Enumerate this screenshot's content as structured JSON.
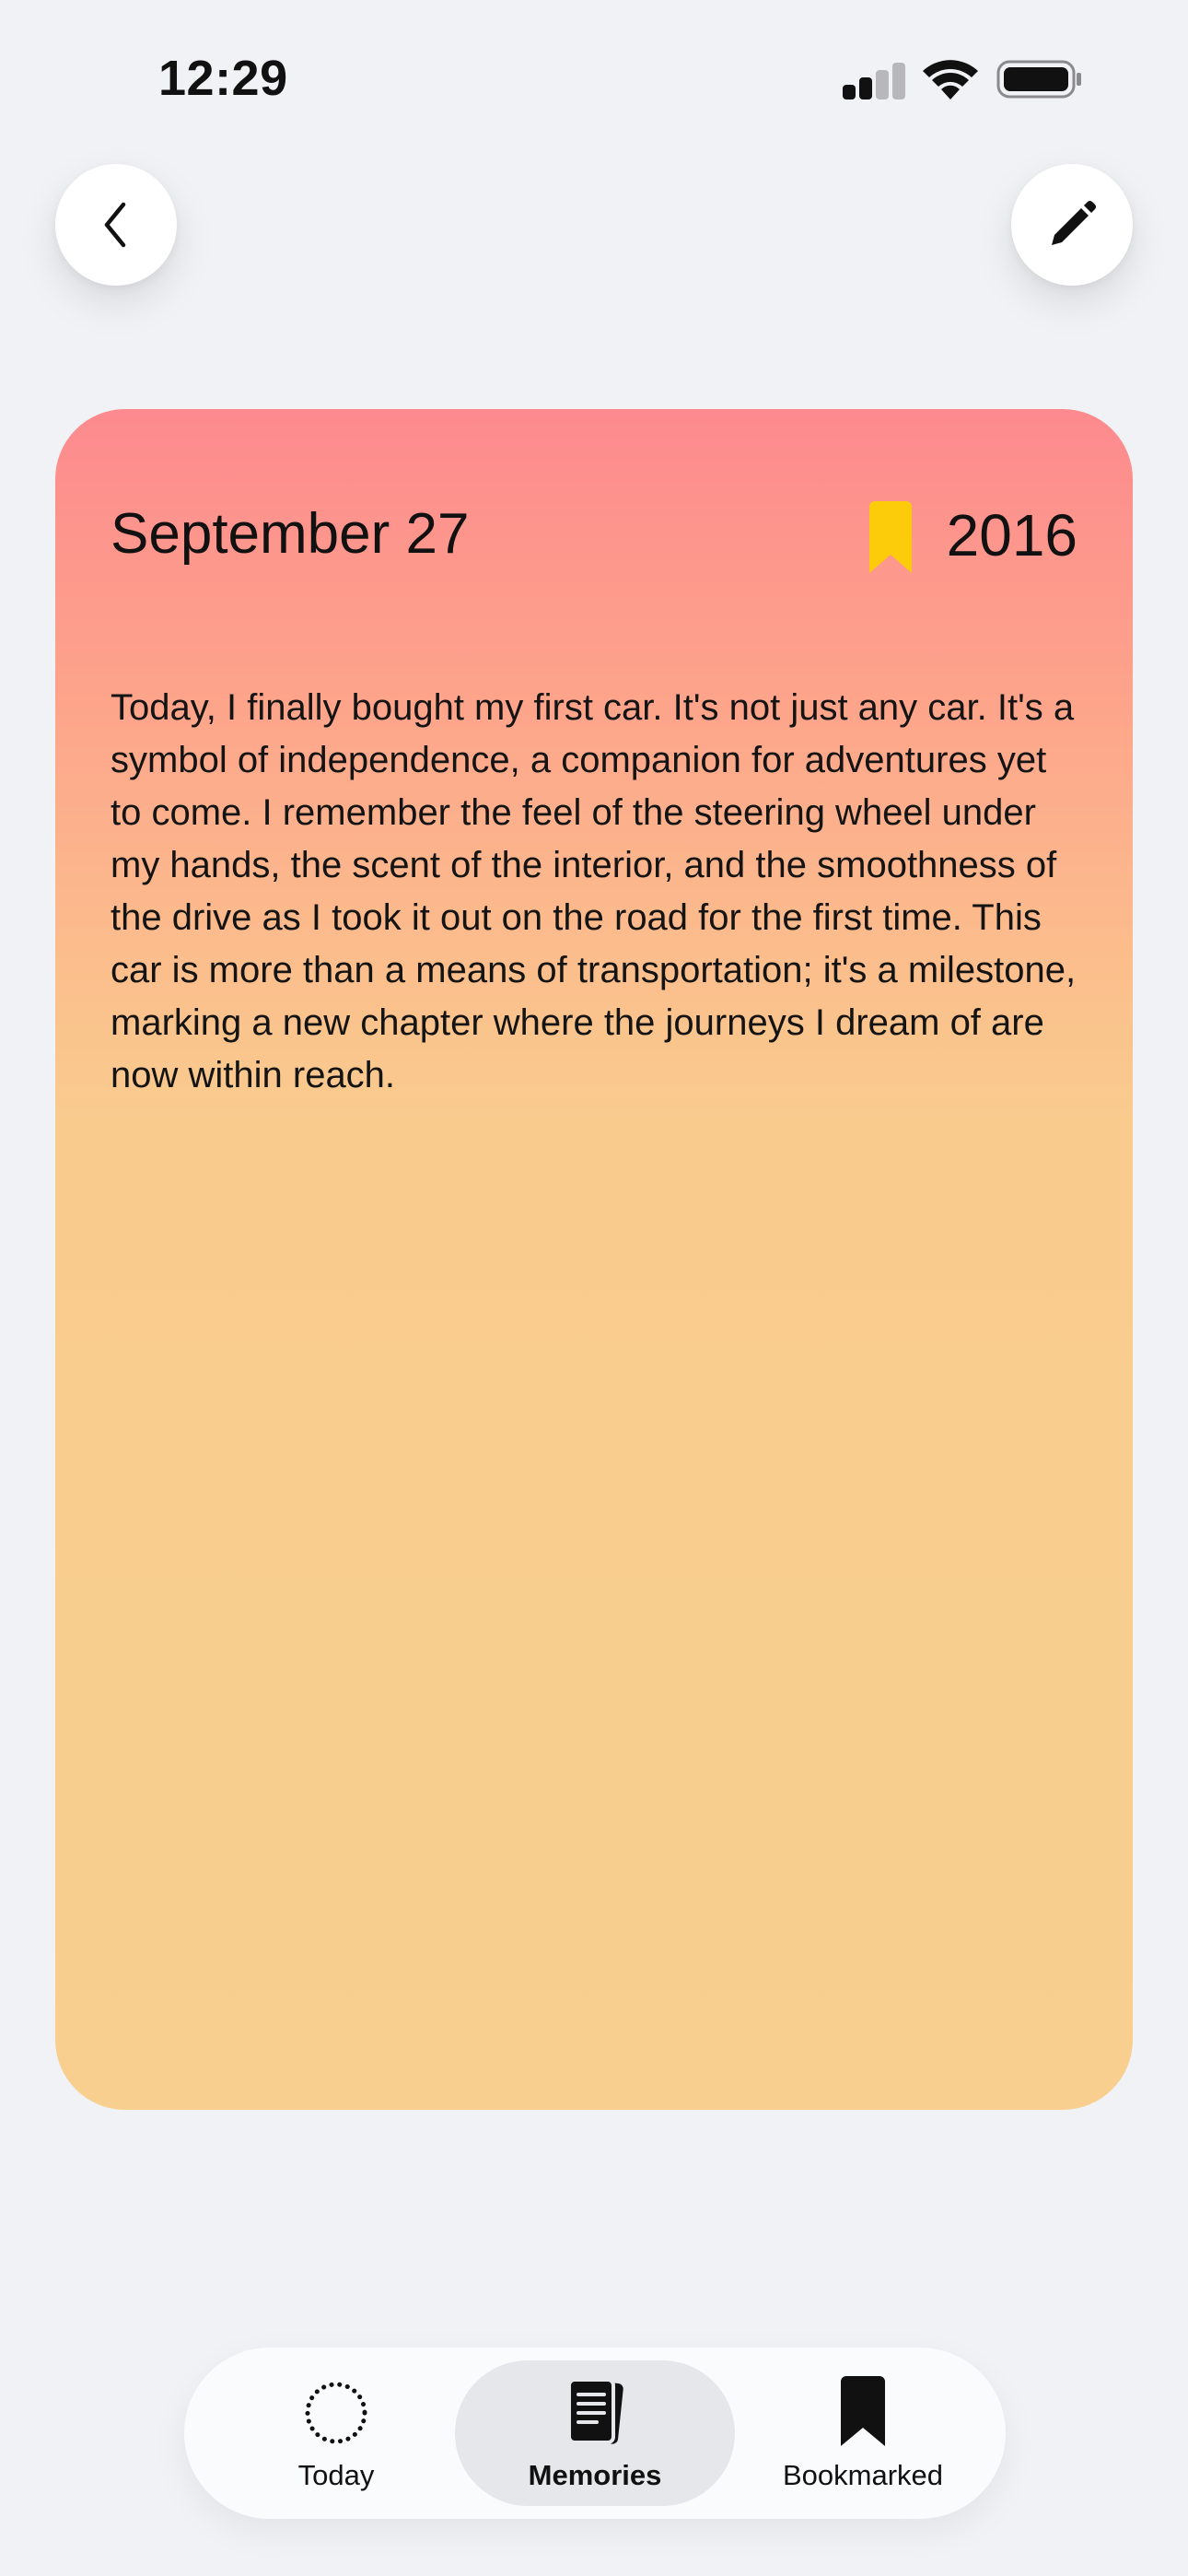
{
  "status_bar": {
    "time": "12:29"
  },
  "header": {
    "back_icon": "chevron-left-icon",
    "edit_icon": "pencil-icon"
  },
  "memory": {
    "date": "September 27",
    "year": "2016",
    "bookmarked": true,
    "body": "Today, I finally bought my first car. It's not just any car. It's a symbol of independence, a companion for adventures yet to come. I remember the feel of the steering wheel under my hands, the scent of the interior, and the smoothness of the drive as I took it out on the road for the first time. This car is more than a means of transportation; it's a milestone, marking a new chapter where the journeys I dream of are now within reach.",
    "colors": {
      "gradient_top": "#fd8a8e",
      "gradient_bottom": "#f8cf8e",
      "bookmark": "#fccc0a"
    }
  },
  "tab_bar": {
    "tabs": [
      {
        "label": "Today",
        "icon": "dotted-circle-icon",
        "selected": false
      },
      {
        "label": "Memories",
        "icon": "journal-icon",
        "selected": true
      },
      {
        "label": "Bookmarked",
        "icon": "bookmark-icon",
        "selected": false
      }
    ]
  }
}
